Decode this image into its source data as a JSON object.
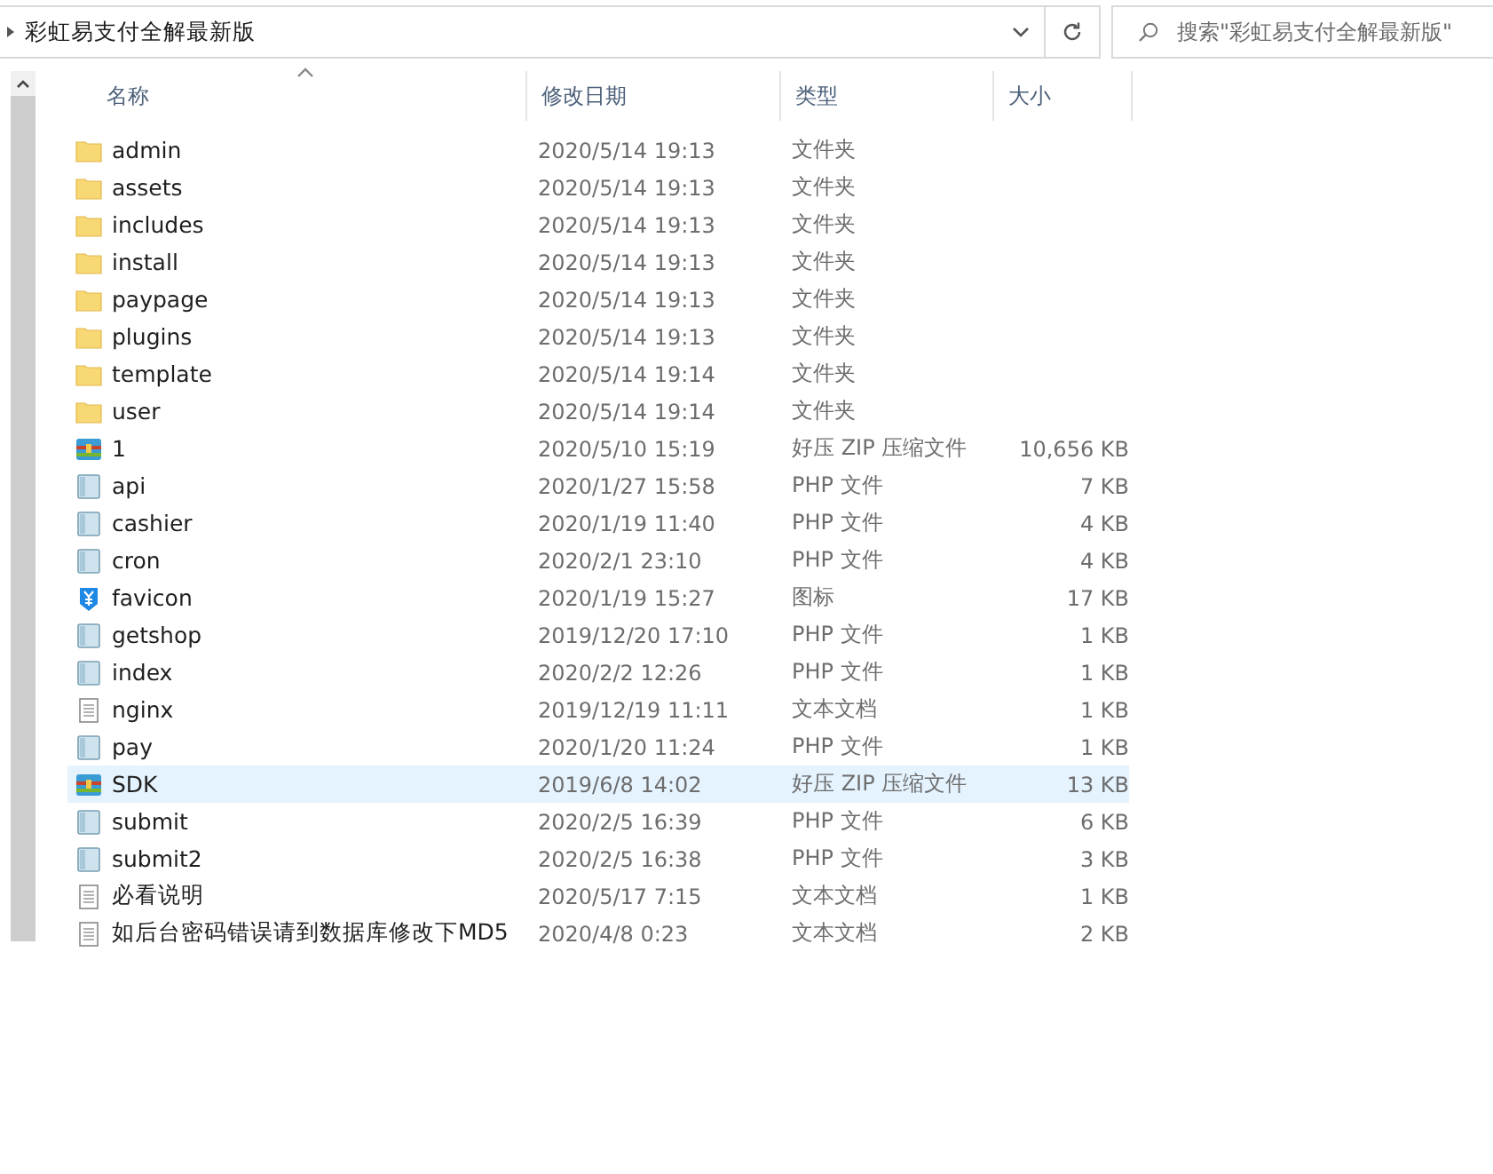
{
  "address_bar": {
    "path": "彩虹易支付全解最新版"
  },
  "search": {
    "placeholder": "搜索\"彩虹易支付全解最新版\""
  },
  "columns": [
    {
      "label": "名称",
      "sorted": true
    },
    {
      "label": "修改日期",
      "sorted": false
    },
    {
      "label": "类型",
      "sorted": false
    },
    {
      "label": "大小",
      "sorted": false
    }
  ],
  "rows": [
    {
      "name": "admin",
      "date": "2020/5/14 19:13",
      "type": "文件夹",
      "kind": "folder",
      "selected": false
    },
    {
      "name": "assets",
      "date": "2020/5/14 19:13",
      "type": "文件夹",
      "kind": "folder",
      "selected": false
    },
    {
      "name": "includes",
      "date": "2020/5/14 19:13",
      "type": "文件夹",
      "kind": "folder",
      "selected": false
    },
    {
      "name": "install",
      "date": "2020/5/14 19:13",
      "type": "文件夹",
      "kind": "folder",
      "selected": false
    },
    {
      "name": "paypage",
      "date": "2020/5/14 19:13",
      "type": "文件夹",
      "kind": "folder",
      "selected": false
    },
    {
      "name": "plugins",
      "date": "2020/5/14 19:13",
      "type": "文件夹",
      "kind": "folder",
      "selected": false
    },
    {
      "name": "template",
      "date": "2020/5/14 19:14",
      "type": "文件夹",
      "kind": "folder",
      "selected": false
    },
    {
      "name": "user",
      "date": "2020/5/14 19:14",
      "type": "文件夹",
      "kind": "folder",
      "selected": false
    },
    {
      "name": "1",
      "date": "2020/5/10 15:19",
      "type": "好压 ZIP 压缩文件",
      "size": "10,656 KB",
      "kind": "zip",
      "selected": false
    },
    {
      "name": "api",
      "date": "2020/1/27 15:58",
      "type": "PHP 文件",
      "size": "7 KB",
      "kind": "php",
      "selected": false
    },
    {
      "name": "cashier",
      "date": "2020/1/19 11:40",
      "type": "PHP 文件",
      "size": "4 KB",
      "kind": "php",
      "selected": false
    },
    {
      "name": "cron",
      "date": "2020/2/1 23:10",
      "type": "PHP 文件",
      "size": "4 KB",
      "kind": "php",
      "selected": false
    },
    {
      "name": "favicon",
      "date": "2020/1/19 15:27",
      "type": "图标",
      "size": "17 KB",
      "kind": "ico",
      "selected": false
    },
    {
      "name": "getshop",
      "date": "2019/12/20 17:10",
      "type": "PHP 文件",
      "size": "1 KB",
      "kind": "php",
      "selected": false
    },
    {
      "name": "index",
      "date": "2020/2/2 12:26",
      "type": "PHP 文件",
      "size": "1 KB",
      "kind": "php",
      "selected": false
    },
    {
      "name": "nginx",
      "date": "2019/12/19 11:11",
      "type": "文本文档",
      "size": "1 KB",
      "kind": "txt",
      "selected": false
    },
    {
      "name": "pay",
      "date": "2020/1/20 11:24",
      "type": "PHP 文件",
      "size": "1 KB",
      "kind": "php",
      "selected": false
    },
    {
      "name": "SDK",
      "date": "2019/6/8 14:02",
      "type": "好压 ZIP 压缩文件",
      "size": "13 KB",
      "kind": "zip",
      "selected": true
    },
    {
      "name": "submit",
      "date": "2020/2/5 16:39",
      "type": "PHP 文件",
      "size": "6 KB",
      "kind": "php",
      "selected": false
    },
    {
      "name": "submit2",
      "date": "2020/2/5 16:38",
      "type": "PHP 文件",
      "size": "3 KB",
      "kind": "php",
      "selected": false
    },
    {
      "name": "必看说明",
      "date": "2020/5/17 7:15",
      "type": "文本文档",
      "size": "1 KB",
      "kind": "txt",
      "selected": false
    },
    {
      "name": "如后台密码错误请到数据库修改下MD5",
      "date": "2020/4/8 0:23",
      "type": "文本文档",
      "size": "2 KB",
      "kind": "txt",
      "selected": false
    }
  ]
}
